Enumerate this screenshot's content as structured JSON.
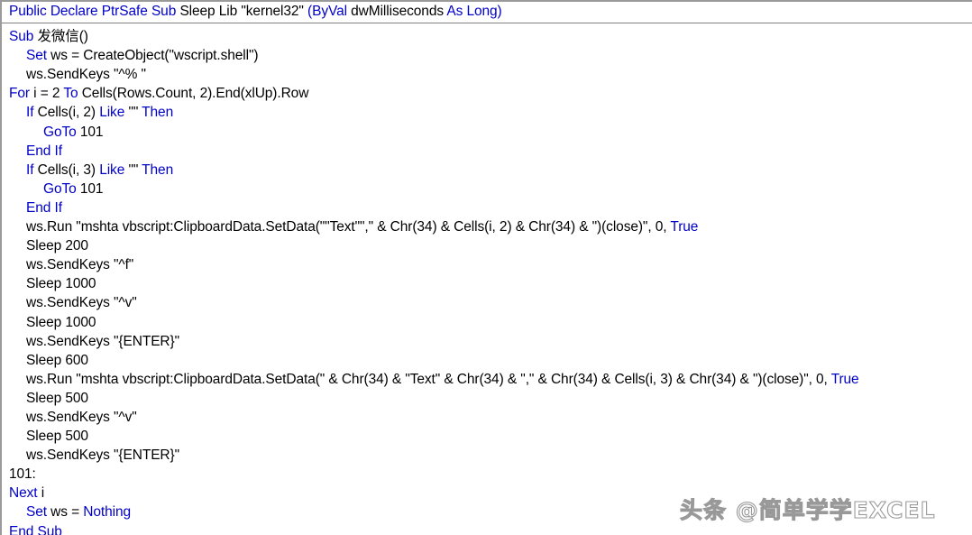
{
  "window": {
    "kind": "vba-code-editor",
    "title": "",
    "background_color": "#ffffff",
    "keyword_color": "#0000C8",
    "plain_color": "#000000",
    "border_color": "#9a9a9a",
    "separator_color": "#808080"
  },
  "watermark": {
    "text": "头条 @简单学学EXCEL"
  },
  "declaration_line": {
    "indent": 0,
    "tokens": [
      {
        "t": "Public Declare PtrSafe Sub ",
        "c": "kw"
      },
      {
        "t": "Sleep Lib \"kernel32\" ",
        "c": "pl"
      },
      {
        "t": "(ByVal ",
        "c": "kw"
      },
      {
        "t": "dwMilliseconds ",
        "c": "pl"
      },
      {
        "t": "As Long)",
        "c": "kw"
      }
    ],
    "plain": "Public Declare PtrSafe Sub Sleep Lib \"kernel32\" (ByVal dwMilliseconds As Long)"
  },
  "code_lines": [
    {
      "indent": 0,
      "plain": "Sub 发微信()",
      "tokens": [
        {
          "t": "Sub ",
          "c": "kw"
        },
        {
          "t": "发微信()",
          "c": "pl"
        }
      ]
    },
    {
      "indent": 1,
      "plain": "Set ws = CreateObject(\"wscript.shell\")",
      "tokens": [
        {
          "t": "Set ",
          "c": "kw"
        },
        {
          "t": "ws = CreateObject(\"wscript.shell\")",
          "c": "pl"
        }
      ]
    },
    {
      "indent": 1,
      "plain": "ws.SendKeys \"^% \"",
      "tokens": [
        {
          "t": "ws.SendKeys \"^% \"",
          "c": "pl"
        }
      ]
    },
    {
      "indent": 0,
      "plain": "For i = 2 To Cells(Rows.Count, 2).End(xlUp).Row",
      "tokens": [
        {
          "t": "For ",
          "c": "kw"
        },
        {
          "t": "i = 2 ",
          "c": "pl"
        },
        {
          "t": "To ",
          "c": "kw"
        },
        {
          "t": "Cells(Rows.Count, 2).End(xlUp).Row",
          "c": "pl"
        }
      ]
    },
    {
      "indent": 1,
      "plain": "If Cells(i, 2) Like \"\" Then",
      "tokens": [
        {
          "t": "If ",
          "c": "kw"
        },
        {
          "t": "Cells(i, 2) ",
          "c": "pl"
        },
        {
          "t": "Like ",
          "c": "kw"
        },
        {
          "t": "\"\" ",
          "c": "pl"
        },
        {
          "t": "Then",
          "c": "kw"
        }
      ]
    },
    {
      "indent": 2,
      "plain": "GoTo 101",
      "tokens": [
        {
          "t": "GoTo ",
          "c": "kw"
        },
        {
          "t": "101",
          "c": "pl"
        }
      ]
    },
    {
      "indent": 1,
      "plain": "End If",
      "tokens": [
        {
          "t": "End If",
          "c": "kw"
        }
      ]
    },
    {
      "indent": 1,
      "plain": "If Cells(i, 3) Like \"\" Then",
      "tokens": [
        {
          "t": "If ",
          "c": "kw"
        },
        {
          "t": "Cells(i, 3) ",
          "c": "pl"
        },
        {
          "t": "Like ",
          "c": "kw"
        },
        {
          "t": "\"\" ",
          "c": "pl"
        },
        {
          "t": "Then",
          "c": "kw"
        }
      ]
    },
    {
      "indent": 2,
      "plain": "GoTo 101",
      "tokens": [
        {
          "t": "GoTo ",
          "c": "kw"
        },
        {
          "t": "101",
          "c": "pl"
        }
      ]
    },
    {
      "indent": 1,
      "plain": "End If",
      "tokens": [
        {
          "t": "End If",
          "c": "kw"
        }
      ]
    },
    {
      "indent": 1,
      "plain": "ws.Run \"mshta vbscript:ClipboardData.SetData(\"\"Text\"\",\" & Chr(34) & Cells(i, 2) & Chr(34) & \")(close)\", 0, True",
      "tokens": [
        {
          "t": "ws.Run \"mshta vbscript:ClipboardData.SetData(\"\"Text\"\",\" & Chr(34) & Cells(i, 2) & Chr(34) & \")(close)\", 0, ",
          "c": "pl"
        },
        {
          "t": "True",
          "c": "kw"
        }
      ]
    },
    {
      "indent": 1,
      "plain": "Sleep 200",
      "tokens": [
        {
          "t": "Sleep 200",
          "c": "pl"
        }
      ]
    },
    {
      "indent": 1,
      "plain": "ws.SendKeys \"^f\"",
      "tokens": [
        {
          "t": "ws.SendKeys \"^f\"",
          "c": "pl"
        }
      ]
    },
    {
      "indent": 1,
      "plain": "Sleep 1000",
      "tokens": [
        {
          "t": "Sleep 1000",
          "c": "pl"
        }
      ]
    },
    {
      "indent": 1,
      "plain": "ws.SendKeys \"^v\"",
      "tokens": [
        {
          "t": "ws.SendKeys \"^v\"",
          "c": "pl"
        }
      ]
    },
    {
      "indent": 1,
      "plain": "Sleep 1000",
      "tokens": [
        {
          "t": "Sleep 1000",
          "c": "pl"
        }
      ]
    },
    {
      "indent": 1,
      "plain": "ws.SendKeys \"{ENTER}\"",
      "tokens": [
        {
          "t": "ws.SendKeys \"{ENTER}\"",
          "c": "pl"
        }
      ]
    },
    {
      "indent": 1,
      "plain": "Sleep 600",
      "tokens": [
        {
          "t": "Sleep 600",
          "c": "pl"
        }
      ]
    },
    {
      "indent": 1,
      "plain": "ws.Run \"mshta vbscript:ClipboardData.SetData(\" & Chr(34) & \"Text\" & Chr(34) & \",\" & Chr(34) & Cells(i, 3) & Chr(34) & \")(close)\", 0, True",
      "tokens": [
        {
          "t": "ws.Run \"mshta vbscript:ClipboardData.SetData(\" & Chr(34) & \"Text\" & Chr(34) & \",\" & Chr(34) & Cells(i, 3) & Chr(34) & \")(close)\", 0, ",
          "c": "pl"
        },
        {
          "t": "True",
          "c": "kw"
        }
      ]
    },
    {
      "indent": 1,
      "plain": "Sleep 500",
      "tokens": [
        {
          "t": "Sleep 500",
          "c": "pl"
        }
      ]
    },
    {
      "indent": 1,
      "plain": "ws.SendKeys \"^v\"",
      "tokens": [
        {
          "t": "ws.SendKeys \"^v\"",
          "c": "pl"
        }
      ]
    },
    {
      "indent": 1,
      "plain": "Sleep 500",
      "tokens": [
        {
          "t": "Sleep 500",
          "c": "pl"
        }
      ]
    },
    {
      "indent": 1,
      "plain": "ws.SendKeys \"{ENTER}\"",
      "tokens": [
        {
          "t": "ws.SendKeys \"{ENTER}\"",
          "c": "pl"
        }
      ]
    },
    {
      "indent": 0,
      "plain": "101:",
      "tokens": [
        {
          "t": "101:",
          "c": "pl"
        }
      ]
    },
    {
      "indent": 0,
      "plain": "Next i",
      "tokens": [
        {
          "t": "Next ",
          "c": "kw"
        },
        {
          "t": "i",
          "c": "pl"
        }
      ]
    },
    {
      "indent": 1,
      "plain": "Set ws = Nothing",
      "tokens": [
        {
          "t": "Set ",
          "c": "kw"
        },
        {
          "t": "ws = ",
          "c": "pl"
        },
        {
          "t": "Nothing",
          "c": "kw"
        }
      ]
    },
    {
      "indent": 0,
      "plain": "End Sub",
      "tokens": [
        {
          "t": "End Sub",
          "c": "kw"
        }
      ]
    }
  ]
}
